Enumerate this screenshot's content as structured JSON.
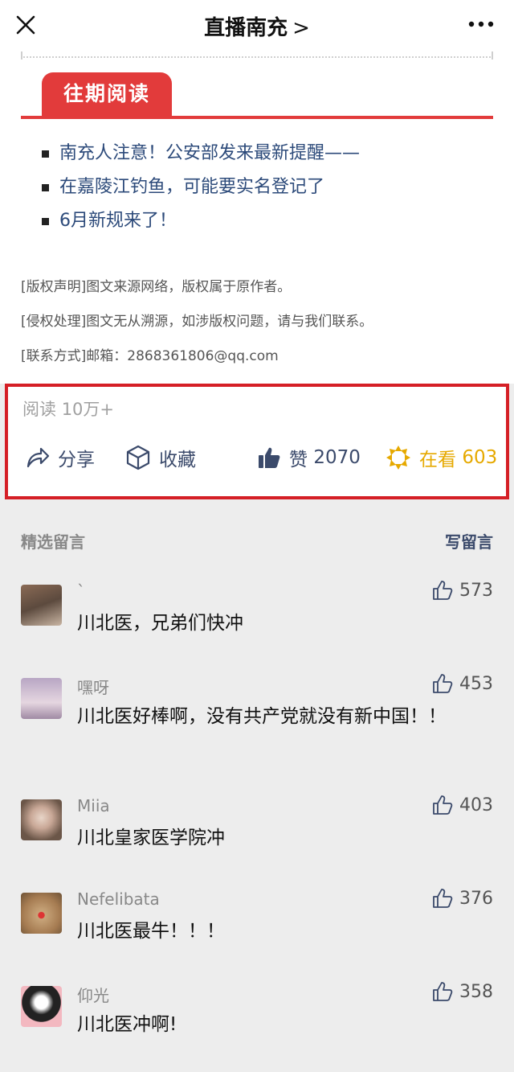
{
  "header": {
    "title": "直播南充",
    "chevron": ">"
  },
  "article": {
    "tab_label": "往期阅读",
    "past_reads": [
      "南充人注意！公安部发来最新提醒——",
      "在嘉陵江钓鱼，可能要实名登记了",
      "6月新规来了！"
    ],
    "notes": [
      "[版权声明]图文来源网络，版权属于原作者。",
      "[侵权处理]图文无从溯源，如涉版权问题，请与我们联系。",
      "[联系方式]邮箱：2868361806@qq.com"
    ]
  },
  "stats": {
    "read_label": "阅读",
    "read_count": "10万+",
    "share_label": "分享",
    "favorite_label": "收藏",
    "like_label": "赞",
    "like_count": "2070",
    "watch_label": "在看",
    "watch_count": "603",
    "watch_color": "#e6a900"
  },
  "comments_section": {
    "title": "精选留言",
    "write_label": "写留言"
  },
  "comments": [
    {
      "name": "`",
      "text": "川北医，兄弟们快冲",
      "likes": "573",
      "avatar_colors": [
        "#8a6a55",
        "#c9b5a3"
      ]
    },
    {
      "name": "嘿呀",
      "text": "川北医好棒啊，没有共产党就没有新中国！！",
      "likes": "453",
      "avatar_colors": [
        "#b8a6c4",
        "#e5d6e0"
      ]
    },
    {
      "name": "Miia",
      "text": "川北皇家医学院冲",
      "likes": "403",
      "avatar_colors": [
        "#d9c3b5",
        "#6b5648"
      ]
    },
    {
      "name": "Nefelibata",
      "text": "川北医最牛！！！",
      "likes": "376",
      "avatar_colors": [
        "#c8a57a",
        "#d33"
      ]
    },
    {
      "name": "仰光",
      "text": "川北医冲啊!",
      "likes": "358",
      "avatar_colors": [
        "#f3b8c0",
        "#222"
      ]
    }
  ]
}
